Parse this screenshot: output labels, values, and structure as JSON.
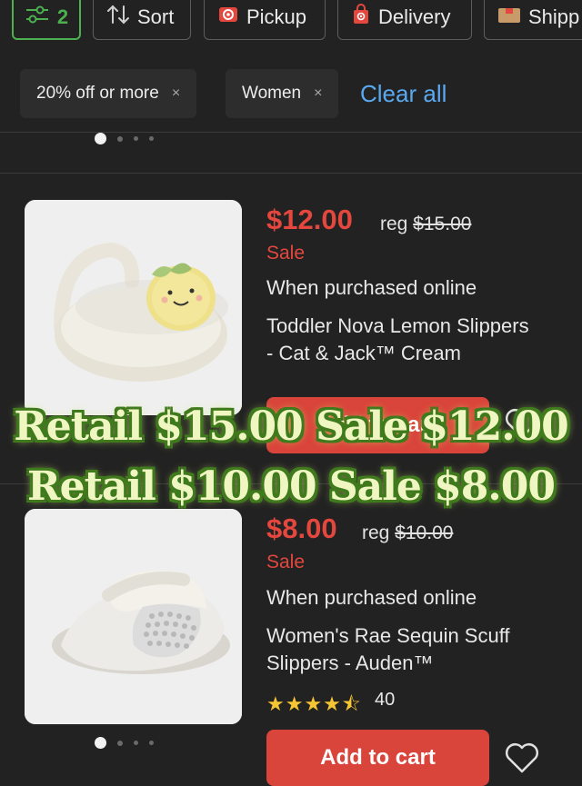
{
  "toolbar": {
    "filter_count": "2",
    "sort_label": "Sort",
    "pickup_label": "Pickup",
    "delivery_label": "Delivery",
    "shipping_label": "Shipp"
  },
  "filters": {
    "chips": [
      {
        "label": "20% off or more",
        "remove": "×"
      },
      {
        "label": "Women",
        "remove": "×"
      }
    ],
    "clear_all": "Clear all"
  },
  "products": [
    {
      "price": "$12.00",
      "reg_prefix": "reg",
      "reg_price": "$15.00",
      "sale_label": "Sale",
      "note": "When purchased online",
      "title_line1": "Toddler Nova Lemon Slippers",
      "title_line2": "- Cat & Jack™ Cream",
      "add_to_cart": "Add to cart"
    },
    {
      "price": "$8.00",
      "reg_prefix": "reg",
      "reg_price": "$10.00",
      "sale_label": "Sale",
      "note": "When purchased online",
      "title_line1": "Women's Rae Sequin Scuff",
      "title_line2": "Slippers - Auden™",
      "rating": 4.5,
      "stars": "★★★★⯪",
      "review_count": "40",
      "add_to_cart": "Add to cart"
    }
  ],
  "overlay": {
    "line1": "Retail $15.00 Sale $12.00",
    "line2": "Retail $10.00 Sale $8.00"
  },
  "colors": {
    "background": "#222222",
    "price_red": "#e4473e",
    "filter_green": "#4caf50",
    "link_blue": "#5aa9f0",
    "star_gold": "#f6c533"
  }
}
